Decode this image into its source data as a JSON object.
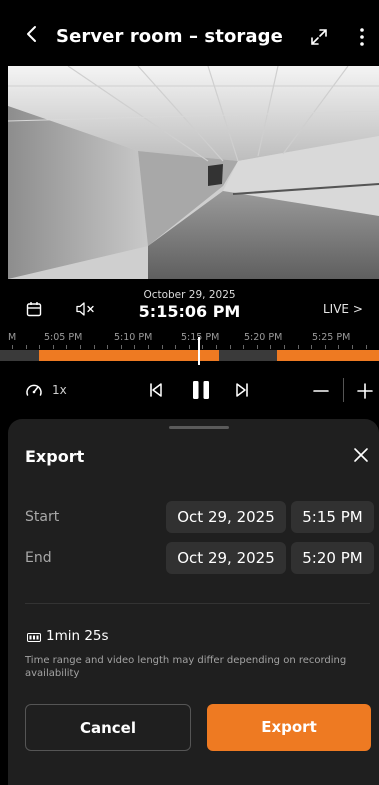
{
  "header": {
    "title": "Server room – storage",
    "icons": {
      "back": "chevron-left-icon",
      "expand": "expand-icon",
      "menu": "more-vertical-icon"
    }
  },
  "player": {
    "date": "October 29, 2025",
    "time": "5:15:06 PM",
    "live_label": "LIVE >",
    "speed": "1x",
    "icons": {
      "calendar": "calendar-icon",
      "mute": "volume-mute-icon",
      "speed": "speedometer-icon",
      "prev": "skip-previous-icon",
      "pause": "pause-icon",
      "next": "skip-next-icon",
      "zoom_out": "minus-icon",
      "zoom_in": "plus-icon"
    }
  },
  "timeline": {
    "labels": [
      "M",
      "5:05 PM",
      "5:10 PM",
      "5:15 PM",
      "5:20 PM",
      "5:25 PM"
    ],
    "accent_color": "#ee7a22"
  },
  "export_sheet": {
    "title": "Export",
    "start_label": "Start",
    "start_date": "Oct 29, 2025",
    "start_time": "5:15 PM",
    "end_label": "End",
    "end_date": "Oct 29, 2025",
    "end_time": "5:20 PM",
    "duration": "1min 25s",
    "note": "Time range and video length may differ depending on recording availability",
    "cancel_label": "Cancel",
    "export_label": "Export",
    "icons": {
      "close": "close-icon",
      "duration": "film-icon"
    }
  }
}
